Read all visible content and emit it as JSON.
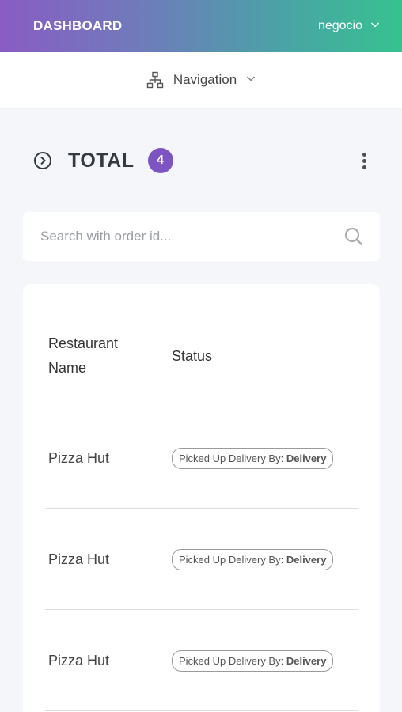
{
  "header": {
    "brand": "DASHBOARD",
    "user": "negocio"
  },
  "nav": {
    "label": "Navigation"
  },
  "summary": {
    "title": "TOTAL",
    "count": "4"
  },
  "search": {
    "placeholder": "Search with order id..."
  },
  "table": {
    "headers": {
      "name_line1": "Restaurant",
      "name_line2": "Name",
      "status": "Status"
    },
    "rows": [
      {
        "name": "Pizza Hut",
        "status": "Picked Up Delivery By:",
        "courier": "Delivery"
      },
      {
        "name": "Pizza Hut",
        "status": "Picked Up Delivery By:",
        "courier": "Delivery"
      },
      {
        "name": "Pizza Hut",
        "status": "Picked Up Delivery By:",
        "courier": "Delivery"
      }
    ]
  },
  "icons": {
    "user_menu": "chevron-down-icon",
    "nav": "sitemap-icon",
    "total": "chevron-right-circle-icon",
    "more": "kebab-menu-icon",
    "search": "search-icon"
  },
  "colors": {
    "header_gradient_start": "#8a5cc4",
    "header_gradient_end": "#36c28f",
    "badge": "#7c55c3",
    "background": "#f5f6fa"
  }
}
